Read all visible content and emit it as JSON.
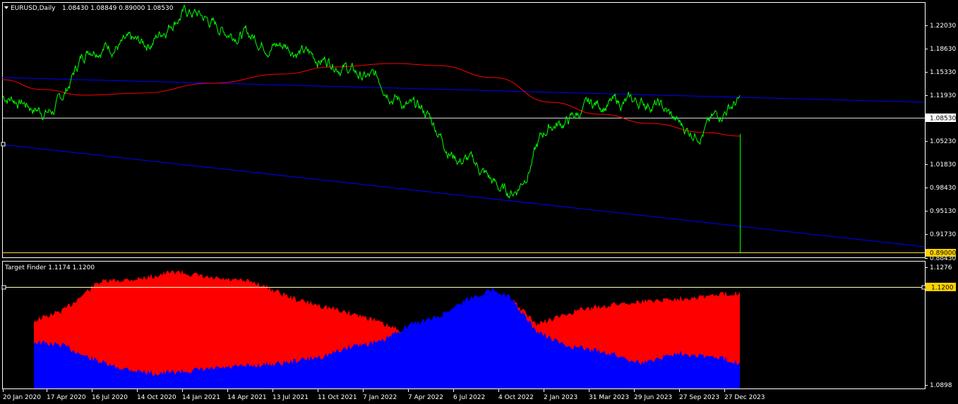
{
  "header": {
    "symbol": "EURUSD,Daily",
    "ohlc": "1.08430 1.08849 0.89000 1.08530",
    "indicator_title": "Target Finder 1.1174 1.1200"
  },
  "price_axis": {
    "labels": [
      "1.22030",
      "1.18630",
      "1.15330",
      "1.11930",
      "1.08530",
      "1.05230",
      "1.01830",
      "0.98430",
      "0.95130",
      "0.91730",
      "0.88430"
    ],
    "current_price": "1.08530",
    "low_marker": "0.89000"
  },
  "indicator_axis": {
    "top_label": "1.1276",
    "level_label": "1.1200",
    "bottom_label": "1.0898"
  },
  "time_axis": {
    "labels": [
      "20 Jan 2020",
      "17 Apr 2020",
      "16 Jul 2020",
      "14 Oct 2020",
      "14 Jan 2021",
      "14 Apr 2021",
      "13 Jul 2021",
      "11 Oct 2021",
      "7 Jan 2022",
      "7 Apr 2022",
      "6 Jul 2022",
      "4 Oct 2022",
      "2 Jan 2023",
      "31 Mar 2023",
      "29 Jun 2023",
      "27 Sep 2023",
      "27 Dec 2023"
    ]
  },
  "colors": {
    "price_line": "#00ff00",
    "moving_average": "#ff0000",
    "channel": "#0000ff",
    "horizontal_level": "#ffffff",
    "low_level": "#ffd24a",
    "histogram_red": "#ff0000",
    "histogram_blue": "#0000ff",
    "axis_tag_bg": "#ffd200"
  },
  "chart_data": {
    "type": "line",
    "title": "EURUSD,Daily",
    "x": [
      "20 Jan 2020",
      "17 Apr 2020",
      "16 Jul 2020",
      "14 Oct 2020",
      "14 Jan 2021",
      "14 Apr 2021",
      "13 Jul 2021",
      "11 Oct 2021",
      "7 Jan 2022",
      "7 Apr 2022",
      "6 Jul 2022",
      "4 Oct 2022",
      "2 Jan 2023",
      "31 Mar 2023",
      "29 Jun 2023",
      "27 Sep 2023",
      "27 Dec 2023"
    ],
    "series": [
      {
        "values": [
          1.108,
          1.088,
          1.18,
          1.18,
          1.225,
          1.198,
          1.18,
          1.16,
          1.133,
          1.09,
          1.02,
          0.975,
          1.07,
          1.098,
          1.1,
          1.06,
          1.1
        ]
      }
    ],
    "ylim": [
      0.8843,
      1.2375
    ],
    "grid": false
  }
}
